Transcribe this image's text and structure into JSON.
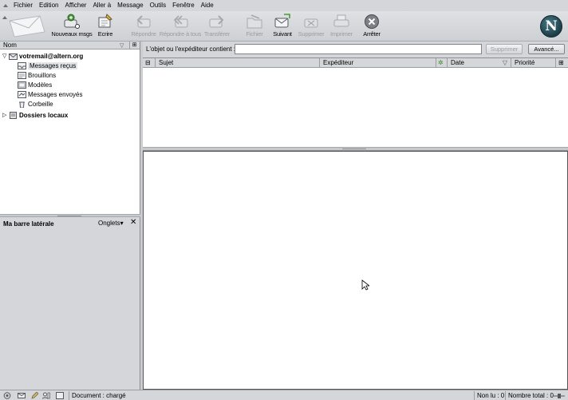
{
  "menu": {
    "items": [
      "Fichier",
      "Edition",
      "Afficher",
      "Aller à",
      "Message",
      "Outils",
      "Fenêtre",
      "Aide"
    ]
  },
  "toolbar": {
    "get_msgs": "Nouveaux msgs",
    "write": "Ecrire",
    "reply": "Répondre",
    "reply_all": "Répondre à tous",
    "forward": "Transférer",
    "file": "Fichier",
    "next": "Suivant",
    "delete": "Supprimer",
    "print": "Imprimer",
    "stop": "Arrêter",
    "brand_letter": "N"
  },
  "folder_pane": {
    "header": "Nom",
    "account": "votremail@altern.org",
    "folders": [
      "Messages reçus",
      "Brouillons",
      "Modèles",
      "Messages envoyés",
      "Corbeille"
    ],
    "local": "Dossiers locaux"
  },
  "sidebar": {
    "title": "Ma barre latérale",
    "tabs_label": "Onglets",
    "close": "✕"
  },
  "search": {
    "label": "L'objet ou l'expéditeur contient :",
    "value": "",
    "clear_button": "Supprimer",
    "advanced_button": "Avancé..."
  },
  "thread_columns": {
    "subject": "Sujet",
    "sender": "Expéditeur",
    "date": "Date",
    "priority": "Priorité"
  },
  "status": {
    "document": "Document : chargé",
    "unread": "Non lu : 0",
    "total": "Nombre total : 0"
  },
  "colors": {
    "chrome": "#d4d6d9",
    "selected": "#e3e5e9",
    "brand": "#1b3e48"
  }
}
